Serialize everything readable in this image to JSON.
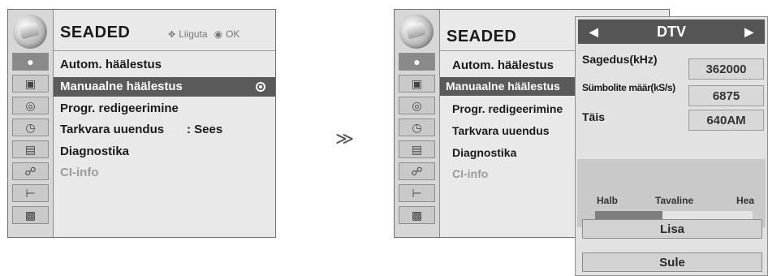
{
  "left_panel": {
    "title": "SEADED",
    "hint_move_label": "Liiguta",
    "hint_ok_label": "OK",
    "items": [
      {
        "label": "Autom. häälestus",
        "value": ""
      },
      {
        "label": "Manuaalne häälestus",
        "value": ""
      },
      {
        "label": "Progr. redigeerimine",
        "value": ""
      },
      {
        "label": "Tarkvara uuendus",
        "value": ": Sees"
      },
      {
        "label": "Diagnostika",
        "value": ""
      },
      {
        "label": "CI-info",
        "value": ""
      }
    ],
    "selected_index": 1
  },
  "transition_arrow": "≫",
  "right_panel": {
    "title": "SEADED",
    "items": [
      {
        "label": "Autom. häälestus"
      },
      {
        "label": "Manuaalne häälestus"
      },
      {
        "label": "Progr. redigeerimine"
      },
      {
        "label": "Tarkvara uuendus"
      },
      {
        "label": "Diagnostika"
      },
      {
        "label": "CI-info"
      }
    ]
  },
  "popup": {
    "mode_label": "DTV",
    "fields": [
      {
        "label": "Sagedus(kHz)",
        "value": "362000"
      },
      {
        "label": "Sümbolite määr(kS/s)",
        "value": "6875"
      },
      {
        "label": "Täis",
        "value": "640AM"
      }
    ],
    "signal": {
      "low_label": "Halb",
      "mid_label": "Tavaline",
      "high_label": "Hea",
      "level_fraction": 0.43
    },
    "add_button": "Lisa",
    "close_button": "Sule"
  },
  "sidebar_icons": [
    "setup-icon",
    "picture-icon",
    "audio-icon",
    "time-icon",
    "option-icon",
    "lock-icon",
    "input-icon",
    "usb-icon"
  ],
  "colors": {
    "highlight": "#5a5a5a",
    "panel_bg": "#e9e9e9"
  }
}
